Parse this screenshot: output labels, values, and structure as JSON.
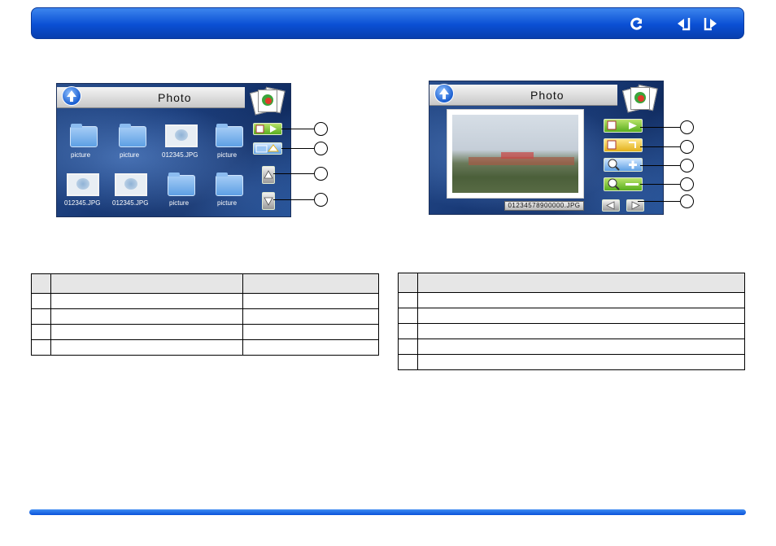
{
  "header": {
    "buttons": [
      {
        "icon": "return-icon"
      },
      {
        "icon": "previous-page-icon"
      },
      {
        "icon": "next-page-icon"
      }
    ]
  },
  "browse_screen": {
    "title": "Photo",
    "items": [
      {
        "type": "folder",
        "label": "picture"
      },
      {
        "type": "folder",
        "label": "picture"
      },
      {
        "type": "image",
        "label": "012345.JPG"
      },
      {
        "type": "folder",
        "label": "picture"
      },
      {
        "type": "image",
        "label": "012345.JPG"
      },
      {
        "type": "image",
        "label": "012345.JPG"
      },
      {
        "type": "folder",
        "label": "picture"
      },
      {
        "type": "folder",
        "label": "picture"
      }
    ],
    "side_buttons": [
      {
        "icon": "slideshow-icon"
      },
      {
        "icon": "folder-up-icon"
      },
      {
        "icon": "arrow-up-icon"
      },
      {
        "icon": "arrow-down-icon"
      }
    ]
  },
  "viewer_screen": {
    "title": "Photo",
    "filename": "01234578900000.JPG",
    "side_buttons": [
      {
        "icon": "slideshow-icon"
      },
      {
        "icon": "rotate-icon"
      },
      {
        "icon": "zoom-in-icon"
      },
      {
        "icon": "zoom-out-icon"
      },
      {
        "icon": "prev-next-icon"
      }
    ]
  },
  "colors": {
    "header_blue": "#0a4fd4",
    "screen_blue": "#1a3c7a",
    "button_green": "#58ae1f"
  }
}
